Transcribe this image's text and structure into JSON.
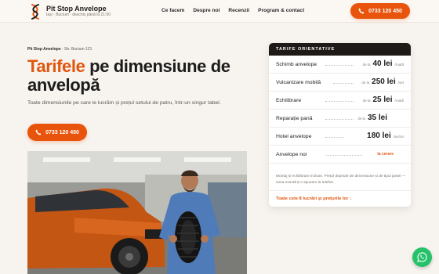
{
  "brand": {
    "name": "Pit Stop Anvelope",
    "subtitle": "Iași · Bucium · deschis până la 21:00"
  },
  "nav": {
    "items": [
      "Ce facem",
      "Despre noi",
      "Recenzii",
      "Program & contact"
    ]
  },
  "header": {
    "phone_label": "0733 120 450"
  },
  "hero": {
    "eyebrow_brand": "Pit Stop Anvelope",
    "eyebrow_address": "· Str. Bucium 121",
    "title_accent": "Tarifele",
    "title_rest": " pe dimensiune de anvelopă",
    "description": "Toate dimensiunile pe care le lucrăm și prețul setului de patru, într-un singur tabel.",
    "phone_label": "0733 120 450"
  },
  "prices": {
    "heading": "TARIFE ORIENTATIVE",
    "rows": [
      {
        "name": "Schimb anvelope",
        "from": "de la",
        "amount": "40 lei",
        "unit": "/roată"
      },
      {
        "name": "Vulcanizare mobilă",
        "from": "de la",
        "amount": "250 lei",
        "unit": "/set"
      },
      {
        "name": "Echilibrare",
        "from": "de la",
        "amount": "25 lei",
        "unit": "/roată"
      },
      {
        "name": "Reparație pană",
        "from": "de la",
        "amount": "35 lei",
        "unit": ""
      },
      {
        "name": "Hotel anvelope",
        "from": "",
        "amount": "180 lei",
        "unit": "/sezon"
      },
      {
        "name": "Anvelope noi",
        "from": "",
        "amount": "",
        "unit": "",
        "request": "la cerere"
      }
    ],
    "note": "Montaj și echilibrare incluse. Prețul depinde de dimensiune și de tipul jantei — suna exactă ți-o spunem la telefon.",
    "all_link": "Toate cele 8 lucrări și prețurile lor ↓"
  },
  "colors": {
    "accent": "#e8540c",
    "dark": "#1e1a17",
    "background": "#f7f3ee",
    "whatsapp": "#25c26a"
  },
  "icons": {
    "logo": "logo-icon",
    "phone": "phone-icon",
    "whatsapp": "whatsapp-icon"
  }
}
